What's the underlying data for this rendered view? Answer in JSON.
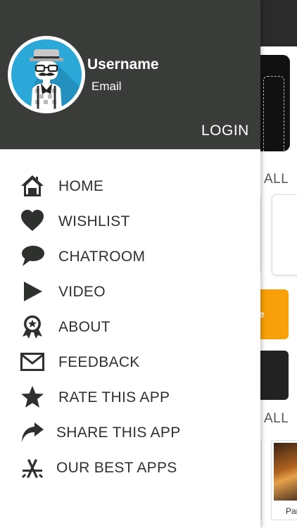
{
  "header": {
    "username": "Username",
    "email": "Email",
    "login_label": "LOGIN",
    "avatar_icon": "hipster-avatar-icon"
  },
  "menu": {
    "items": [
      {
        "label": "HOME",
        "icon": "home-icon"
      },
      {
        "label": "WISHLIST",
        "icon": "heart-icon"
      },
      {
        "label": "CHATROOM",
        "icon": "chat-bubble-icon"
      },
      {
        "label": "VIDEO",
        "icon": "play-icon"
      },
      {
        "label": "ABOUT",
        "icon": "award-ribbon-icon"
      },
      {
        "label": "FEEDBACK",
        "icon": "envelope-icon"
      },
      {
        "label": "RATE THIS APP",
        "icon": "star-icon"
      },
      {
        "label": "SHARE THIS APP",
        "icon": "share-arrow-icon"
      },
      {
        "label": "OUR BEST APPS",
        "icon": "app-store-icon"
      }
    ]
  },
  "background": {
    "see_all_1": "ALL",
    "see_all_2": "ALL",
    "orange_card_text": "e",
    "thumb_caption": "Par"
  },
  "colors": {
    "header_bg": "#393c38",
    "avatar_bg": "#2ba7d8",
    "menu_text": "#2f312e",
    "accent_orange": "#f8a00a"
  }
}
